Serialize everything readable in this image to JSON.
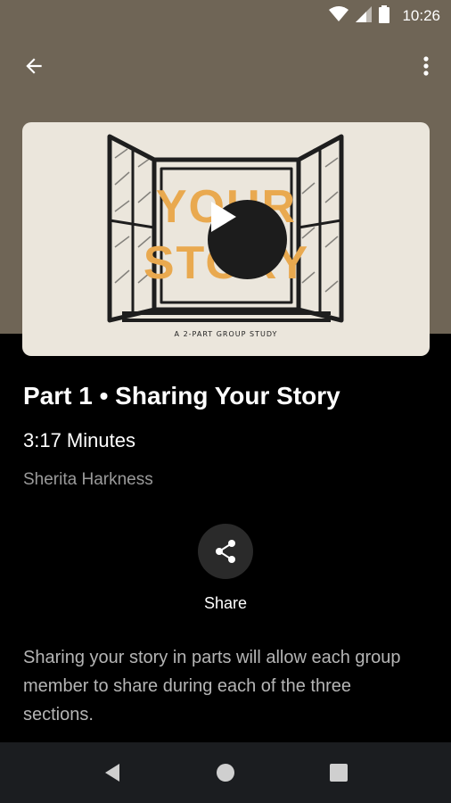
{
  "status_bar": {
    "time": "10:26",
    "icons": [
      "wifi-icon",
      "cellular-signal-icon",
      "battery-icon"
    ]
  },
  "app_bar": {
    "back_icon": "arrow-left-icon",
    "more_icon": "more-vert-icon"
  },
  "video": {
    "artwork_title_line1": "YOUR",
    "artwork_title_line2": "STORY",
    "artwork_caption": "A 2-PART GROUP STUDY",
    "play_icon": "play-icon"
  },
  "episode": {
    "title": "Part 1 • Sharing Your Story",
    "duration": "3:17 Minutes",
    "author": "Sherita Harkness"
  },
  "share": {
    "label": "Share",
    "icon": "share-icon"
  },
  "description": "Sharing your story in parts will allow each group member to share during each of the three sections.",
  "nav_bar": {
    "icons": [
      "back-triangle-icon",
      "home-circle-icon",
      "recents-square-icon"
    ]
  },
  "colors": {
    "header": "#6f6556",
    "background": "#000000",
    "artwork_bg": "#ebe6dc",
    "artwork_accent": "#e9a94f",
    "secondary_text": "#9a9a9a"
  }
}
